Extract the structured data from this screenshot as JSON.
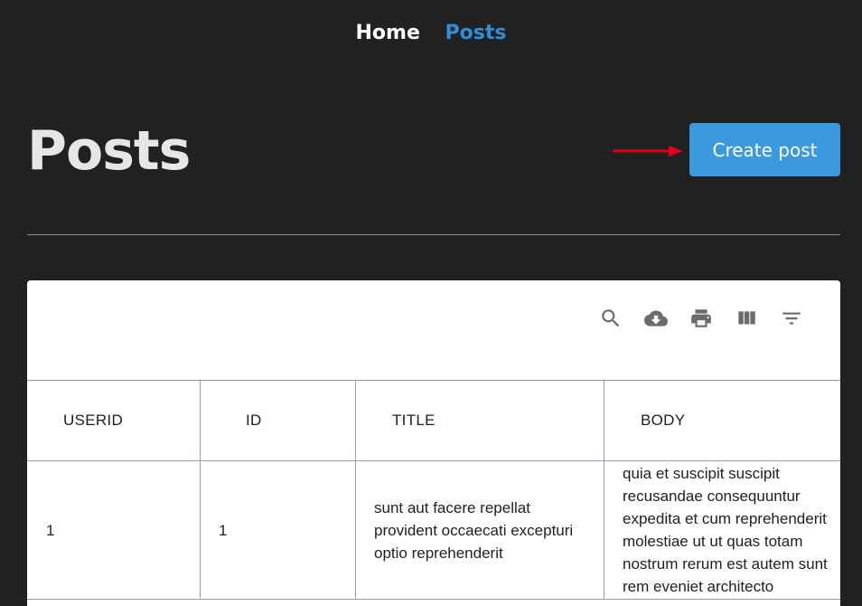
{
  "nav": {
    "home_label": "Home",
    "posts_label": "Posts"
  },
  "page": {
    "title": "Posts",
    "create_button_label": "Create post"
  },
  "toolbar": {
    "icons": [
      "search-icon",
      "cloud-download-icon",
      "print-icon",
      "view-columns-icon",
      "filter-list-icon"
    ]
  },
  "colors": {
    "background": "#212121",
    "accent": "#3b99e0",
    "nav_active": "#2f8fd9",
    "arrow": "#e0001a"
  },
  "table": {
    "columns": [
      "USERID",
      "ID",
      "TITLE",
      "BODY"
    ],
    "rows": [
      {
        "userId": "1",
        "id": "1",
        "title": "sunt aut facere repellat provident occaecati excepturi optio reprehenderit",
        "body": "quia et suscipit suscipit recusandae consequuntur expedita et cum reprehenderit molestiae ut ut quas totam nostrum rerum est autem sunt rem eveniet architecto"
      }
    ]
  }
}
